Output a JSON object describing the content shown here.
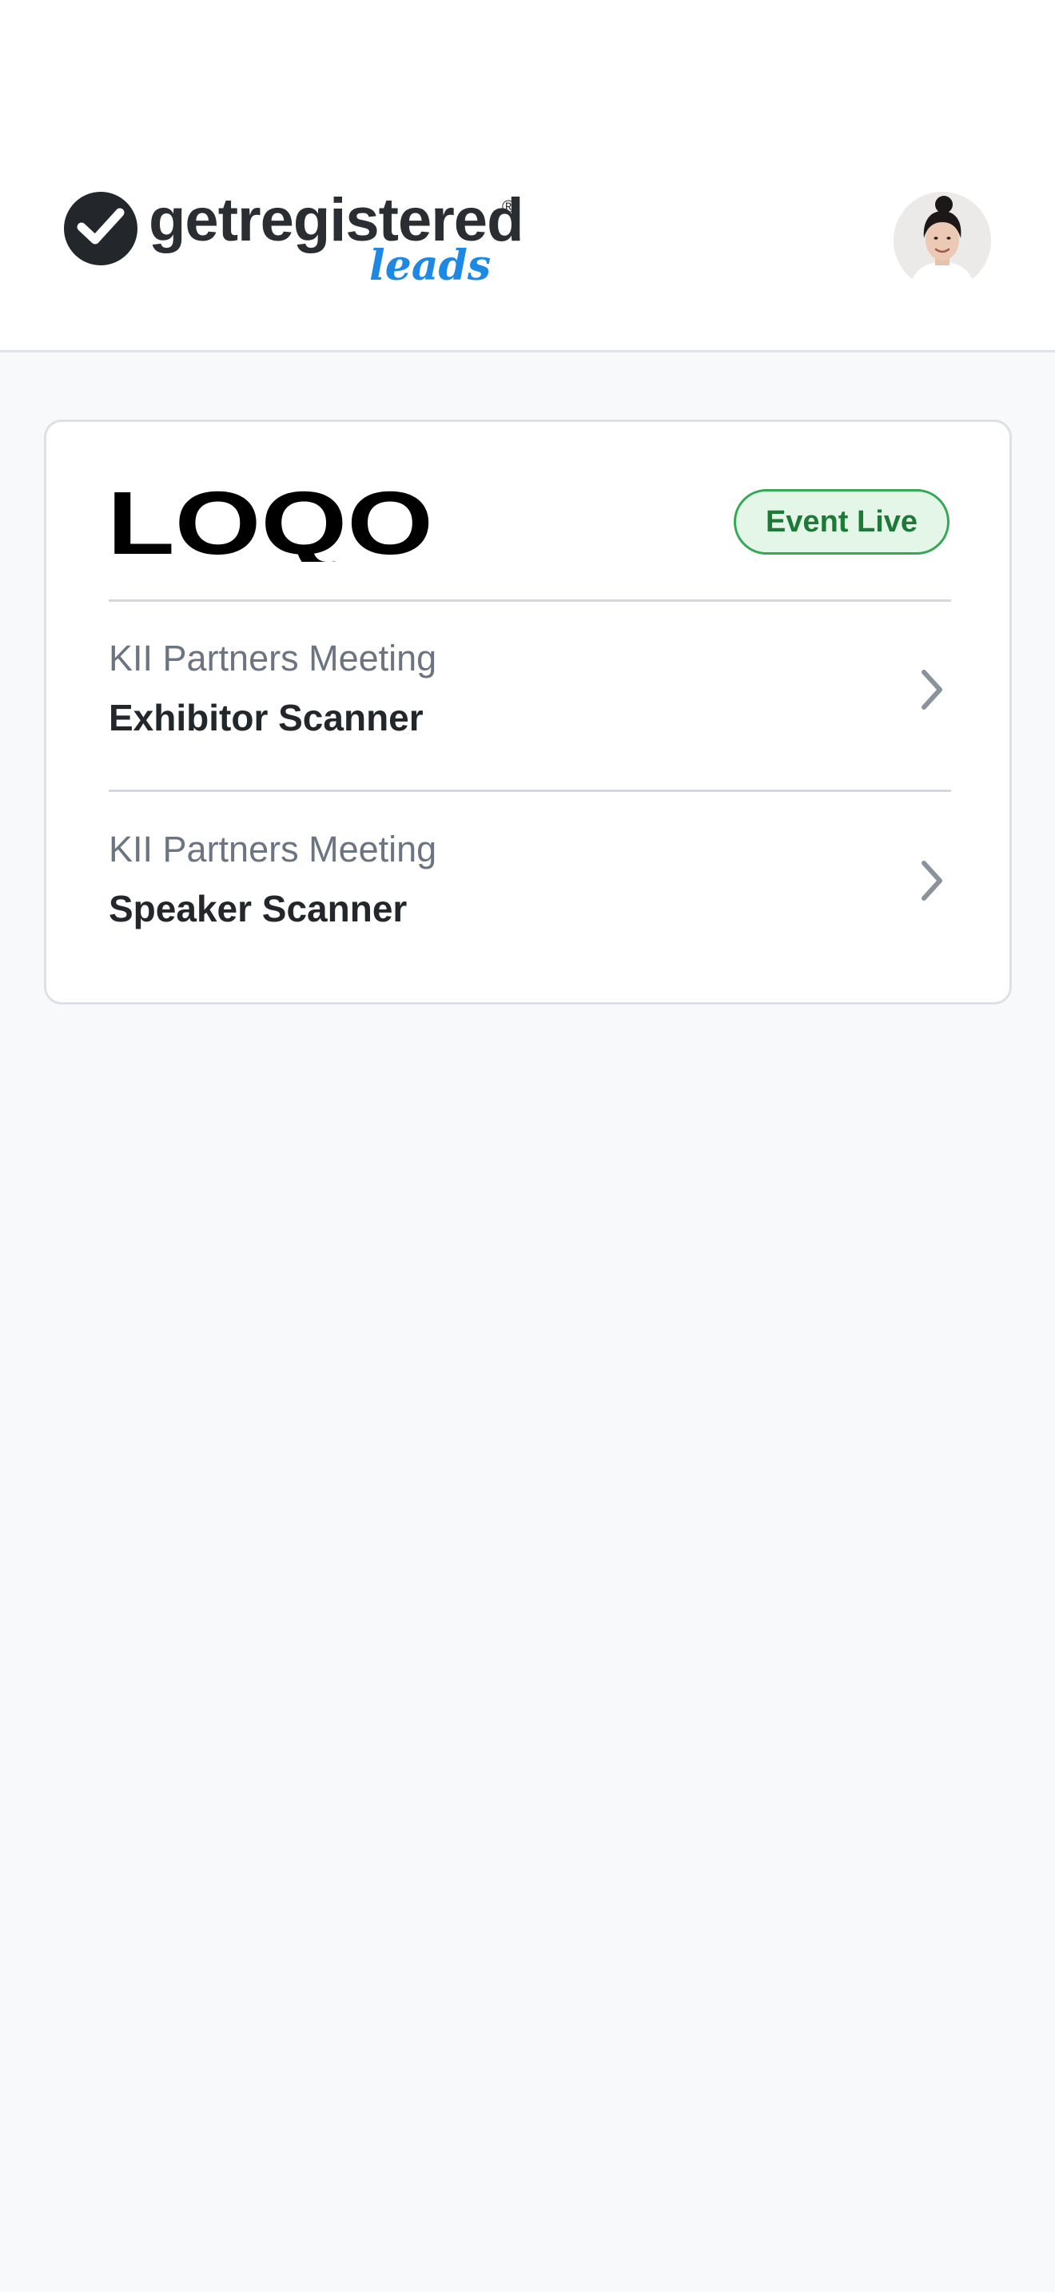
{
  "header": {
    "brand_name": "getregistered",
    "brand_registered": "®",
    "brand_subtitle": "leads",
    "brand_color": "#1e88e5",
    "avatar_icon": "user-avatar-photo"
  },
  "event": {
    "logo_text": "LOQO",
    "status": "Event Live",
    "status_color": "#34a853",
    "items": [
      {
        "event_name": "KII Partners Meeting",
        "scanner": "Exhibitor Scanner",
        "icon": "chevron-right-icon"
      },
      {
        "event_name": "KII Partners Meeting",
        "scanner": "Speaker Scanner",
        "icon": "chevron-right-icon"
      }
    ]
  }
}
